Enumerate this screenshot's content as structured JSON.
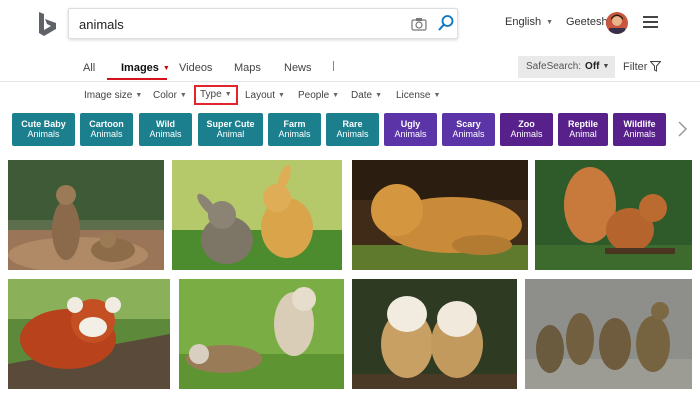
{
  "search": {
    "query": "animals"
  },
  "header": {
    "language": "English",
    "user_name": "Geetesh"
  },
  "scope_tabs": [
    "All",
    "Images",
    "Videos",
    "Maps",
    "News"
  ],
  "safesearch": {
    "label": "SafeSearch:",
    "value": "Off"
  },
  "filter_label": "Filter",
  "filters": [
    "Image size",
    "Color",
    "Type",
    "Layout",
    "People",
    "Date",
    "License"
  ],
  "categories": [
    {
      "line1": "Cute Baby",
      "line2": "Animals",
      "color": "#1b7f8d"
    },
    {
      "line1": "Cartoon",
      "line2": "Animals",
      "color": "#1b7f8d"
    },
    {
      "line1": "Wild",
      "line2": "Animals",
      "color": "#1b7f8d"
    },
    {
      "line1": "Super Cute",
      "line2": "Animal",
      "color": "#1b7f8d"
    },
    {
      "line1": "Farm",
      "line2": "Animals",
      "color": "#1b7f8d"
    },
    {
      "line1": "Rare",
      "line2": "Animals",
      "color": "#1b7f8d"
    },
    {
      "line1": "Ugly",
      "line2": "Animals",
      "color": "#5b35a8"
    },
    {
      "line1": "Scary",
      "line2": "Animals",
      "color": "#5b35a8"
    },
    {
      "line1": "Zoo",
      "line2": "Animals",
      "color": "#57208b"
    },
    {
      "line1": "Reptile",
      "line2": "Animal",
      "color": "#57208b"
    },
    {
      "line1": "Wildlife",
      "line2": "Animals",
      "color": "#57208b"
    }
  ],
  "images": [
    {
      "subject": "prairie dogs"
    },
    {
      "subject": "bunnies"
    },
    {
      "subject": "lion cub"
    },
    {
      "subject": "squirrel"
    },
    {
      "subject": "red panda"
    },
    {
      "subject": "ferrets"
    },
    {
      "subject": "barn owls"
    },
    {
      "subject": "ducklings"
    }
  ],
  "accent_color": "#d4131c"
}
